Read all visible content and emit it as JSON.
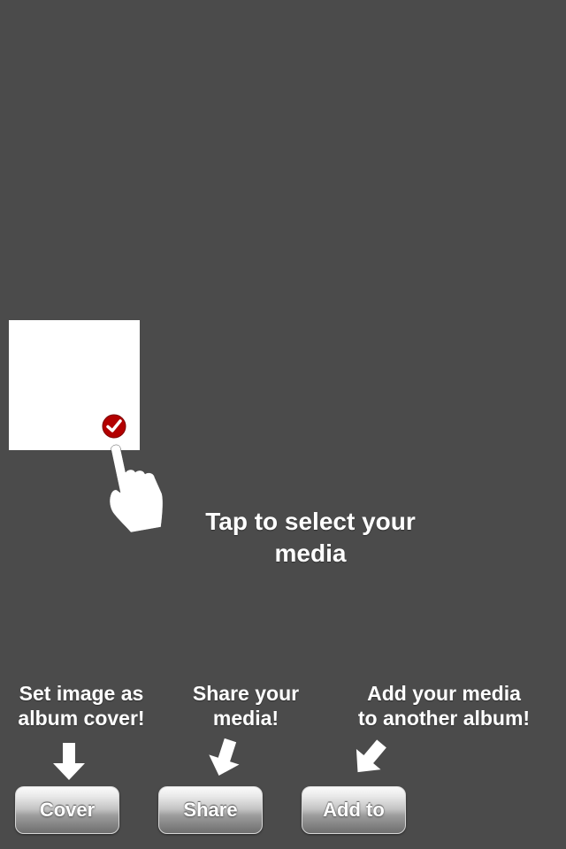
{
  "tutorial": {
    "select_hint": "Tap to select your media"
  },
  "captions": {
    "cover": [
      "Set image as",
      "album cover!"
    ],
    "share": [
      "Share your",
      "media!"
    ],
    "add_to": [
      "Add your media",
      "to another album!"
    ]
  },
  "buttons": {
    "cover_label": "Cover",
    "share_label": "Share",
    "add_to_label": "Add to"
  },
  "colors": {
    "background": "#4b4b4b",
    "checkmark_badge": "#b30000"
  },
  "icons": {
    "selected": "checkmark-icon",
    "pointer": "hand-pointer-icon",
    "arrow": "arrow-icon"
  }
}
